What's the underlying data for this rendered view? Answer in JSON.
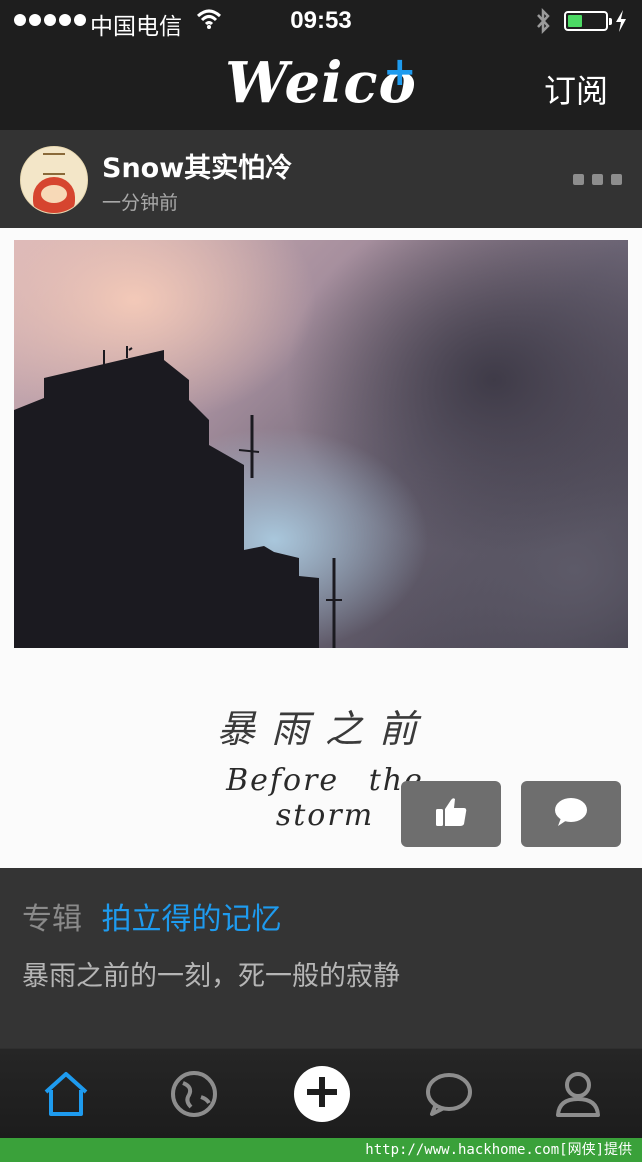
{
  "status_bar": {
    "carrier": "中国电信",
    "time": "09:53",
    "battery_level": 0.45
  },
  "nav": {
    "logo": "Weico",
    "logo_plus": "+",
    "subscribe_label": "订阅"
  },
  "post": {
    "username": "Snow其实怕冷",
    "time_ago": "一分钟前",
    "caption_cn": "暴雨之前",
    "caption_en": "Before the storm"
  },
  "album": {
    "label": "专辑",
    "name": "拍立得的记忆",
    "description": "暴雨之前的一刻，死一般的寂静"
  },
  "icons": {
    "like": "thumbs-up-icon",
    "comment": "speech-bubble-icon",
    "home": "home-icon",
    "discover": "globe-icon",
    "compose": "plus-icon",
    "messages": "chat-icon",
    "profile": "person-icon"
  },
  "colors": {
    "accent": "#1e9bef",
    "background": "#1e1e1e",
    "card": "#fbfbfb",
    "panel": "#343434"
  },
  "watermark": "http://www.hackhome.com[网侠]提供"
}
